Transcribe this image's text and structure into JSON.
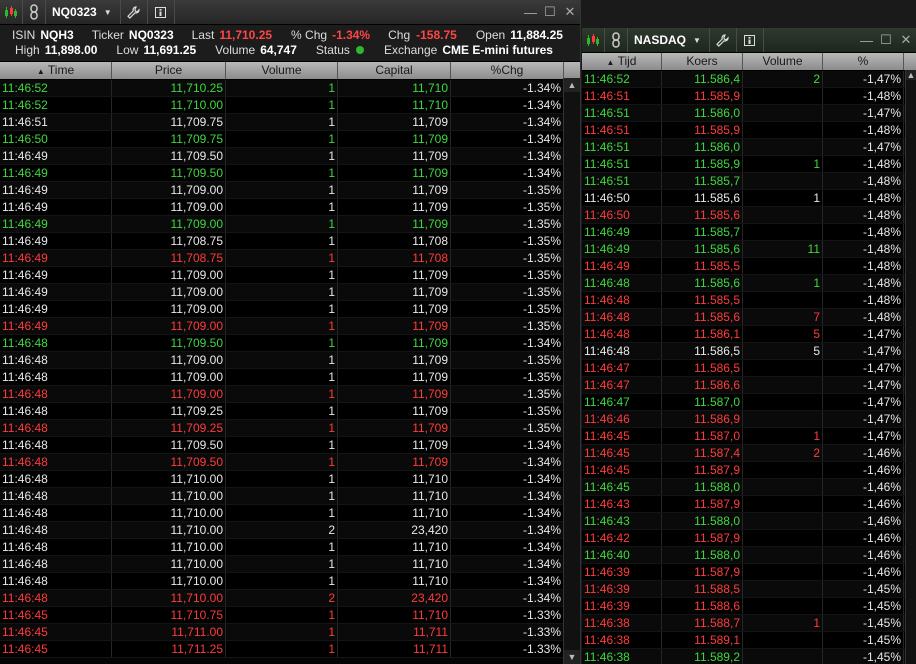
{
  "window1": {
    "title": "NQ0323",
    "info": {
      "isin_label": "ISIN",
      "isin": "NQH3",
      "ticker_label": "Ticker",
      "ticker": "NQ0323",
      "last_label": "Last",
      "last": "11,710.25",
      "pchg_label": "% Chg",
      "pchg": "-1.34%",
      "chg_label": "Chg",
      "chg": "-158.75",
      "open_label": "Open",
      "open": "11,884.25",
      "high_label": "High",
      "high": "11,898.00",
      "low_label": "Low",
      "low": "11,691.25",
      "volume_label": "Volume",
      "volume": "64,747",
      "status_label": "Status",
      "exchange_label": "Exchange",
      "exchange": "CME E-mini futures"
    },
    "columns": [
      "Time",
      "Price",
      "Volume",
      "Capital",
      "%Chg"
    ],
    "rows": [
      {
        "t": "11:46:52",
        "p": "11,710.25",
        "v": "1",
        "c": "11,710",
        "pc": "-1.34%",
        "d": "up"
      },
      {
        "t": "11:46:52",
        "p": "11,710.00",
        "v": "1",
        "c": "11,710",
        "pc": "-1.34%",
        "d": "up"
      },
      {
        "t": "11:46:51",
        "p": "11,709.75",
        "v": "1",
        "c": "11,709",
        "pc": "-1.34%",
        "d": "nt"
      },
      {
        "t": "11:46:50",
        "p": "11,709.75",
        "v": "1",
        "c": "11,709",
        "pc": "-1.34%",
        "d": "up"
      },
      {
        "t": "11:46:49",
        "p": "11,709.50",
        "v": "1",
        "c": "11,709",
        "pc": "-1.34%",
        "d": "nt"
      },
      {
        "t": "11:46:49",
        "p": "11,709.50",
        "v": "1",
        "c": "11,709",
        "pc": "-1.34%",
        "d": "up"
      },
      {
        "t": "11:46:49",
        "p": "11,709.00",
        "v": "1",
        "c": "11,709",
        "pc": "-1.35%",
        "d": "nt"
      },
      {
        "t": "11:46:49",
        "p": "11,709.00",
        "v": "1",
        "c": "11,709",
        "pc": "-1.35%",
        "d": "nt"
      },
      {
        "t": "11:46:49",
        "p": "11,709.00",
        "v": "1",
        "c": "11,709",
        "pc": "-1.35%",
        "d": "up"
      },
      {
        "t": "11:46:49",
        "p": "11,708.75",
        "v": "1",
        "c": "11,708",
        "pc": "-1.35%",
        "d": "nt"
      },
      {
        "t": "11:46:49",
        "p": "11,708.75",
        "v": "1",
        "c": "11,708",
        "pc": "-1.35%",
        "d": "dn"
      },
      {
        "t": "11:46:49",
        "p": "11,709.00",
        "v": "1",
        "c": "11,709",
        "pc": "-1.35%",
        "d": "nt"
      },
      {
        "t": "11:46:49",
        "p": "11,709.00",
        "v": "1",
        "c": "11,709",
        "pc": "-1.35%",
        "d": "nt"
      },
      {
        "t": "11:46:49",
        "p": "11,709.00",
        "v": "1",
        "c": "11,709",
        "pc": "-1.35%",
        "d": "nt"
      },
      {
        "t": "11:46:49",
        "p": "11,709.00",
        "v": "1",
        "c": "11,709",
        "pc": "-1.35%",
        "d": "dn"
      },
      {
        "t": "11:46:48",
        "p": "11,709.50",
        "v": "1",
        "c": "11,709",
        "pc": "-1.34%",
        "d": "up"
      },
      {
        "t": "11:46:48",
        "p": "11,709.00",
        "v": "1",
        "c": "11,709",
        "pc": "-1.35%",
        "d": "nt"
      },
      {
        "t": "11:46:48",
        "p": "11,709.00",
        "v": "1",
        "c": "11,709",
        "pc": "-1.35%",
        "d": "nt"
      },
      {
        "t": "11:46:48",
        "p": "11,709.00",
        "v": "1",
        "c": "11,709",
        "pc": "-1.35%",
        "d": "dn"
      },
      {
        "t": "11:46:48",
        "p": "11,709.25",
        "v": "1",
        "c": "11,709",
        "pc": "-1.35%",
        "d": "nt"
      },
      {
        "t": "11:46:48",
        "p": "11,709.25",
        "v": "1",
        "c": "11,709",
        "pc": "-1.35%",
        "d": "dn"
      },
      {
        "t": "11:46:48",
        "p": "11,709.50",
        "v": "1",
        "c": "11,709",
        "pc": "-1.34%",
        "d": "nt"
      },
      {
        "t": "11:46:48",
        "p": "11,709.50",
        "v": "1",
        "c": "11,709",
        "pc": "-1.34%",
        "d": "dn"
      },
      {
        "t": "11:46:48",
        "p": "11,710.00",
        "v": "1",
        "c": "11,710",
        "pc": "-1.34%",
        "d": "nt"
      },
      {
        "t": "11:46:48",
        "p": "11,710.00",
        "v": "1",
        "c": "11,710",
        "pc": "-1.34%",
        "d": "nt"
      },
      {
        "t": "11:46:48",
        "p": "11,710.00",
        "v": "1",
        "c": "11,710",
        "pc": "-1.34%",
        "d": "nt"
      },
      {
        "t": "11:46:48",
        "p": "11,710.00",
        "v": "2",
        "c": "23,420",
        "pc": "-1.34%",
        "d": "nt"
      },
      {
        "t": "11:46:48",
        "p": "11,710.00",
        "v": "1",
        "c": "11,710",
        "pc": "-1.34%",
        "d": "nt"
      },
      {
        "t": "11:46:48",
        "p": "11,710.00",
        "v": "1",
        "c": "11,710",
        "pc": "-1.34%",
        "d": "nt"
      },
      {
        "t": "11:46:48",
        "p": "11,710.00",
        "v": "1",
        "c": "11,710",
        "pc": "-1.34%",
        "d": "nt"
      },
      {
        "t": "11:46:48",
        "p": "11,710.00",
        "v": "2",
        "c": "23,420",
        "pc": "-1.34%",
        "d": "dn"
      },
      {
        "t": "11:46:45",
        "p": "11,710.75",
        "v": "1",
        "c": "11,710",
        "pc": "-1.33%",
        "d": "dn"
      },
      {
        "t": "11:46:45",
        "p": "11,711.00",
        "v": "1",
        "c": "11,711",
        "pc": "-1.33%",
        "d": "dn"
      },
      {
        "t": "11:46:45",
        "p": "11,711.25",
        "v": "1",
        "c": "11,711",
        "pc": "-1.33%",
        "d": "dn"
      }
    ]
  },
  "window2": {
    "title": "NASDAQ",
    "columns": [
      "Tijd",
      "Koers",
      "Volume",
      "%"
    ],
    "rows": [
      {
        "t": "11:46:52",
        "p": "11.586,4",
        "v": "2",
        "pc": "-1,47%",
        "d": "up"
      },
      {
        "t": "11:46:51",
        "p": "11.585,9",
        "v": "",
        "pc": "-1,48%",
        "d": "dn"
      },
      {
        "t": "11:46:51",
        "p": "11.586,0",
        "v": "",
        "pc": "-1,47%",
        "d": "up"
      },
      {
        "t": "11:46:51",
        "p": "11.585,9",
        "v": "",
        "pc": "-1,48%",
        "d": "dn"
      },
      {
        "t": "11:46:51",
        "p": "11.586,0",
        "v": "",
        "pc": "-1,47%",
        "d": "up"
      },
      {
        "t": "11:46:51",
        "p": "11.585,9",
        "v": "1",
        "pc": "-1,48%",
        "d": "up"
      },
      {
        "t": "11:46:51",
        "p": "11.585,7",
        "v": "",
        "pc": "-1,48%",
        "d": "up"
      },
      {
        "t": "11:46:50",
        "p": "11.585,6",
        "v": "1",
        "pc": "-1,48%",
        "d": "nt"
      },
      {
        "t": "11:46:50",
        "p": "11.585,6",
        "v": "",
        "pc": "-1,48%",
        "d": "dn"
      },
      {
        "t": "11:46:49",
        "p": "11.585,7",
        "v": "",
        "pc": "-1,48%",
        "d": "up"
      },
      {
        "t": "11:46:49",
        "p": "11.585,6",
        "v": "11",
        "pc": "-1,48%",
        "d": "up"
      },
      {
        "t": "11:46:49",
        "p": "11.585,5",
        "v": "",
        "pc": "-1,48%",
        "d": "dn"
      },
      {
        "t": "11:46:48",
        "p": "11.585,6",
        "v": "1",
        "pc": "-1,48%",
        "d": "up"
      },
      {
        "t": "11:46:48",
        "p": "11.585,5",
        "v": "",
        "pc": "-1,48%",
        "d": "dn"
      },
      {
        "t": "11:46:48",
        "p": "11.585,6",
        "v": "7",
        "pc": "-1,48%",
        "d": "dn"
      },
      {
        "t": "11:46:48",
        "p": "11.586,1",
        "v": "5",
        "pc": "-1,47%",
        "d": "dn"
      },
      {
        "t": "11:46:48",
        "p": "11.586,5",
        "v": "5",
        "pc": "-1,47%",
        "d": "nt"
      },
      {
        "t": "11:46:47",
        "p": "11.586,5",
        "v": "",
        "pc": "-1,47%",
        "d": "dn"
      },
      {
        "t": "11:46:47",
        "p": "11.586,6",
        "v": "",
        "pc": "-1,47%",
        "d": "dn"
      },
      {
        "t": "11:46:47",
        "p": "11.587,0",
        "v": "",
        "pc": "-1,47%",
        "d": "up"
      },
      {
        "t": "11:46:46",
        "p": "11.586,9",
        "v": "",
        "pc": "-1,47%",
        "d": "dn"
      },
      {
        "t": "11:46:45",
        "p": "11.587,0",
        "v": "1",
        "pc": "-1,47%",
        "d": "dn"
      },
      {
        "t": "11:46:45",
        "p": "11.587,4",
        "v": "2",
        "pc": "-1,46%",
        "d": "dn"
      },
      {
        "t": "11:46:45",
        "p": "11.587,9",
        "v": "",
        "pc": "-1,46%",
        "d": "dn"
      },
      {
        "t": "11:46:45",
        "p": "11.588,0",
        "v": "",
        "pc": "-1,46%",
        "d": "up"
      },
      {
        "t": "11:46:43",
        "p": "11.587,9",
        "v": "",
        "pc": "-1,46%",
        "d": "dn"
      },
      {
        "t": "11:46:43",
        "p": "11.588,0",
        "v": "",
        "pc": "-1,46%",
        "d": "up"
      },
      {
        "t": "11:46:42",
        "p": "11.587,9",
        "v": "",
        "pc": "-1,46%",
        "d": "dn"
      },
      {
        "t": "11:46:40",
        "p": "11.588,0",
        "v": "",
        "pc": "-1,46%",
        "d": "up"
      },
      {
        "t": "11:46:39",
        "p": "11.587,9",
        "v": "",
        "pc": "-1,46%",
        "d": "dn"
      },
      {
        "t": "11:46:39",
        "p": "11.588,5",
        "v": "",
        "pc": "-1,45%",
        "d": "dn"
      },
      {
        "t": "11:46:39",
        "p": "11.588,6",
        "v": "",
        "pc": "-1,45%",
        "d": "dn"
      },
      {
        "t": "11:46:38",
        "p": "11.588,7",
        "v": "1",
        "pc": "-1,45%",
        "d": "dn"
      },
      {
        "t": "11:46:38",
        "p": "11.589,1",
        "v": "",
        "pc": "-1,45%",
        "d": "dn"
      },
      {
        "t": "11:46:38",
        "p": "11.589,2",
        "v": "",
        "pc": "-1,45%",
        "d": "up"
      }
    ]
  },
  "colors": {
    "up": "#3ed83e",
    "down": "#ff3b3b",
    "neutral": "#e8e8e8",
    "status_ok": "#2fb62f"
  },
  "icons": {
    "chart": "candlestick-chart-icon",
    "link": "link-chain-icon",
    "tools": "wrench-icon",
    "info": "info-icon"
  }
}
